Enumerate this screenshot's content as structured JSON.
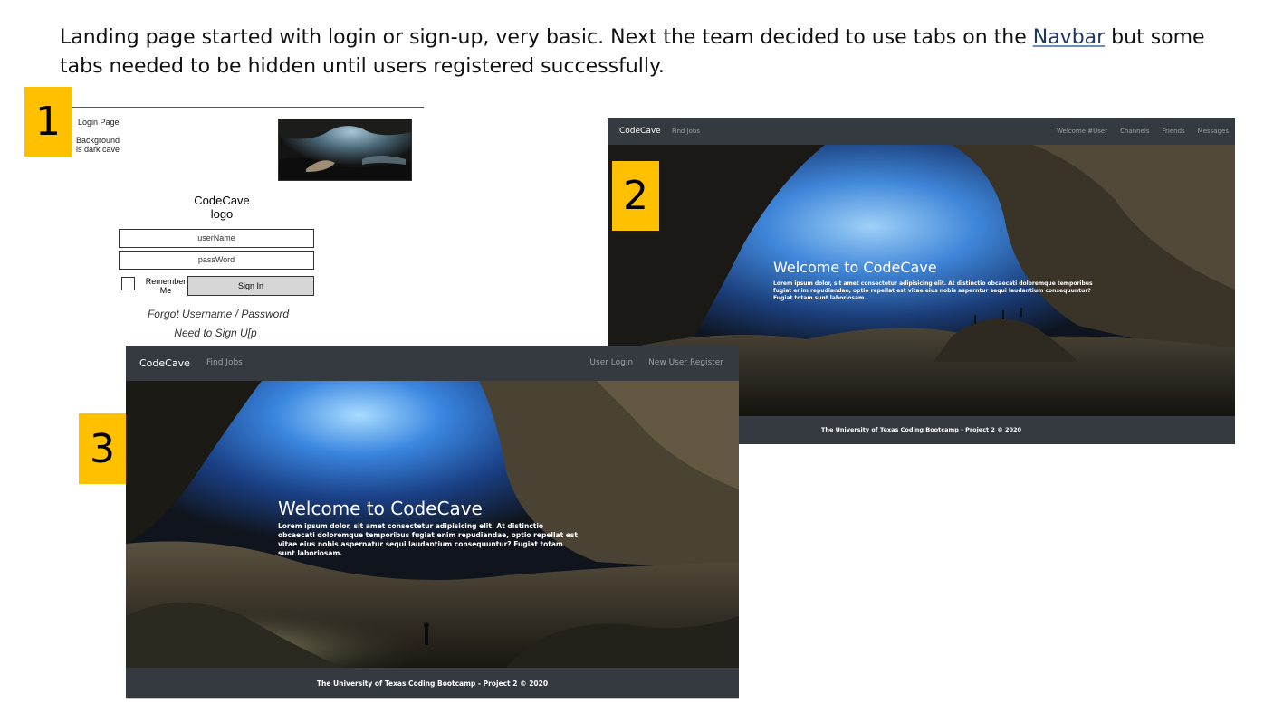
{
  "intro": {
    "line1_before": "Landing page started with login or sign-up, very basic.  Next the team decided to use tabs on the ",
    "line1_link": "Navbar",
    "line1_after": " but some",
    "line2": "tabs needed to be hidden until users registered successfully."
  },
  "badges": [
    "1",
    "2",
    "3"
  ],
  "wireframe": {
    "login_page_label": "Login Page",
    "background_note_line1": "Background",
    "background_note_line2": "is dark cave",
    "logo_line1": "CodeCave",
    "logo_line2": "logo",
    "username_placeholder": "userName",
    "password_placeholder": "passWord",
    "remember_line1": "Remember",
    "remember_line2": "Me",
    "sign_in_label": "Sign In",
    "forgot_label": "Forgot Username / Password",
    "signup_label": "Need to Sign U[p"
  },
  "shot2": {
    "brand": "CodeCave",
    "find_jobs": "Find Jobs",
    "right_links": [
      "Welcome #User",
      "Channels",
      "Friends",
      "Messages"
    ],
    "hero_title": "Welcome to CodeCave",
    "hero_body": "Lorem ipsum dolor, sit amet consectetur adipisicing elit. At distinctio obcaecati doloremque temporibus fugiat enim repudiandae, optio repellat est vitae eius nobis asperntur sequi laudantium consequuntur? Fugiat totam sunt laboriosam.",
    "footer": "The University of Texas Coding Bootcamp - Project 2 © 2020"
  },
  "shot3": {
    "brand": "CodeCave",
    "find_jobs": "Find Jobs",
    "right_links": [
      "User Login",
      "New User Register"
    ],
    "hero_title": "Welcome to CodeCave",
    "hero_body": "Lorem ipsum dolor, sit amet consectetur adipisicing elit. At distinctio obcaecati doloremque temporibus fugiat enim repudiandae, optio repellat est vitae eius nobis aspernatur sequi laudantium consequuntur? Fugiat totam sunt laboriosam.",
    "footer": "The University of Texas Coding Bootcamp - Project 2 © 2020"
  },
  "colors": {
    "badge": "#ffc000",
    "navbar": "#343a40",
    "cave_light": "#3d7fd6",
    "cave_dark": "#15130f"
  }
}
